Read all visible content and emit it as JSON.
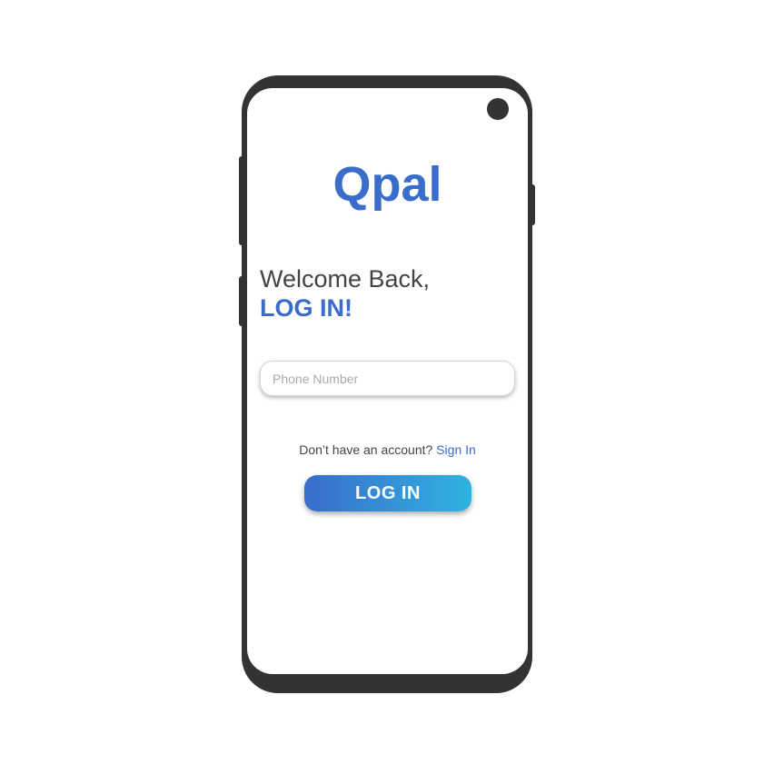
{
  "app": {
    "logo_text": "Qpal",
    "brand_color": "#3a6ccc",
    "gradient_end_color": "#2fb3e0",
    "frame_color": "#333333"
  },
  "login": {
    "welcome_text": "Welcome Back,",
    "heading_text": "LOG IN!",
    "phone_placeholder": "Phone Number",
    "phone_value": "",
    "no_account_text": "Don’t have an account?",
    "sign_in_link_text": "Sign In",
    "login_button_label": "LOG IN"
  }
}
